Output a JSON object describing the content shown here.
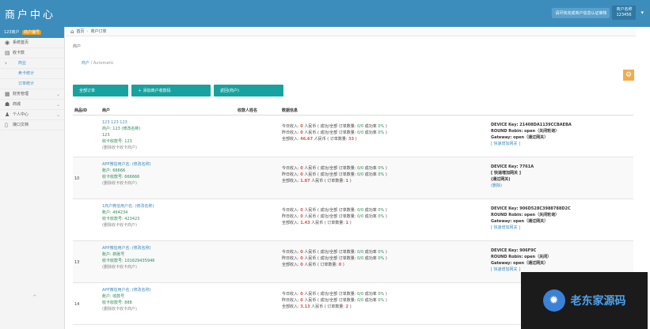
{
  "app": {
    "brand": "商户中心",
    "notice": "请尽快完成商户信息认证审核",
    "user_line1": "商户名称",
    "user_line2": "123456",
    "caret": "▾"
  },
  "sidebar": {
    "header": "123商户",
    "header_tag": "商户编号",
    "items": [
      {
        "icon": "dashboard-icon",
        "glyph": "◉",
        "label": "系统首页",
        "chev": ""
      },
      {
        "icon": "card-icon",
        "glyph": "▤",
        "label": "收卡款",
        "chev": ""
      },
      {
        "icon": "",
        "glyph": "›",
        "label": "商业",
        "chev": "",
        "sub": true
      },
      {
        "icon": "",
        "glyph": "",
        "label": "卖卡统计",
        "chev": "",
        "sub": true
      },
      {
        "icon": "",
        "glyph": "",
        "label": "订单统计",
        "chev": "",
        "sub": true
      },
      {
        "icon": "finance-icon",
        "glyph": "▦",
        "label": "财务管理",
        "chev": "⌄"
      },
      {
        "icon": "users-icon",
        "glyph": "☗",
        "label": "商城",
        "chev": "⌄"
      },
      {
        "icon": "person-icon",
        "glyph": "♟",
        "label": "个人中心",
        "chev": "⌄"
      },
      {
        "icon": "doc-icon",
        "glyph": "▯",
        "label": "接口文档",
        "chev": ""
      }
    ]
  },
  "breadcrumb": {
    "home": "首页",
    "current": "商户订单"
  },
  "page_header": "商户",
  "subcrumb": {
    "link": "商户",
    "sep": "/",
    "current": "Automatic"
  },
  "buttons": [
    "全部订单",
    "添加商户收款码",
    "返回(商户)"
  ],
  "table": {
    "headers": [
      "商品ID",
      "商户",
      "收款人姓名",
      "数据信息"
    ],
    "rows": [
      {
        "id": "",
        "merchant_lines": [
          "123 123 123",
          "商户: 123 (修改名称)",
          "123",
          "收卡收款号: 123",
          "(删除收卡收卡商户)"
        ],
        "data": {
          "today": "0",
          "today_succ": "0/0",
          "today_rate": "0%",
          "yesterday": "0",
          "y_succ": "0/0",
          "y_rate": "0%",
          "total": "46.67",
          "total_count": "33"
        },
        "device": {
          "key": "DEVICE Key: 21408DA1139CCBAEBA",
          "round": "ROUND Robin: open（关闭轮询）",
          "gateway": "Gateway: open（通过网关）",
          "action": "[ 快速增加网关 ]"
        }
      },
      {
        "id": "10",
        "merchant_lines": [
          "APP微信用户名: (修改名称)",
          "账户: 66666",
          "收卡收款号: 666666",
          "(删除收卡收卡商户)"
        ],
        "data": {
          "today": "0",
          "today_succ": "0/0",
          "today_rate": "0%",
          "yesterday": "0",
          "y_succ": "0/0",
          "y_rate": "0%",
          "total": "1.87",
          "total_count": "1"
        },
        "device": {
          "key": "DEVICE Key: 7761A",
          "round": "[ 快速增加网关 ]",
          "gateway": "(通过网关)",
          "action": "(删除)"
        }
      },
      {
        "id": "",
        "merchant_lines": [
          "1商户微信用户名: (修改名称)",
          "账户: 464234",
          "收卡收款号: 423423",
          "(删除收卡收卡商户)"
        ],
        "data": {
          "today": "0",
          "today_succ": "0/0",
          "today_rate": "0%",
          "yesterday": "0",
          "y_succ": "0/0",
          "y_rate": "0%",
          "total": "1.43",
          "total_count": "1"
        },
        "device": {
          "key": "DEVICE Key: 906D528C3988788D2C",
          "round": "ROUND Robin: open（关闭轮询）",
          "gateway": "Gateway: open（通过网关）",
          "action": "[ 快速增加网关 ]"
        }
      },
      {
        "id": "13",
        "merchant_lines": [
          "APP微信用户名: (修改名称)",
          "账户: 新账号",
          "收卡收款号: 101629435946",
          "(删除收卡收卡商户)"
        ],
        "data": {
          "today": "0",
          "today_succ": "0/0",
          "today_rate": "0%",
          "yesterday": "0",
          "y_succ": "0/0",
          "y_rate": "0%",
          "total": "0",
          "total_count": "0"
        },
        "device": {
          "key": "DEVICE Key: 906F9C",
          "round": "ROUND Robin: open（关闭）",
          "gateway": "Gateway: open（通过网关）",
          "action": "[ 快速增加网关 ]"
        }
      },
      {
        "id": "14",
        "merchant_lines": [
          "APP微信用户名: (修改名称)",
          "账户: 收款号",
          "收卡收款号: 888",
          "(删除收卡收卡商户)"
        ],
        "data": {
          "today": "0",
          "today_succ": "0/0",
          "today_rate": "0%",
          "yesterday": "0",
          "y_succ": "0/0",
          "y_rate": "0%",
          "total": "3.13",
          "total_count": "2"
        },
        "device": {
          "key": "",
          "round": "",
          "gateway": "",
          "action": ""
        }
      }
    ],
    "labels": {
      "today": "今日收入:",
      "yesterday": "昨日收入:",
      "total": "全部收入:",
      "currency": "人民币",
      "succ": "成功/全部 订单数量:",
      "rate": "成功率",
      "count": "订单数量:"
    }
  },
  "watermark": "老东家源码",
  "gear_glyph": "⚙"
}
